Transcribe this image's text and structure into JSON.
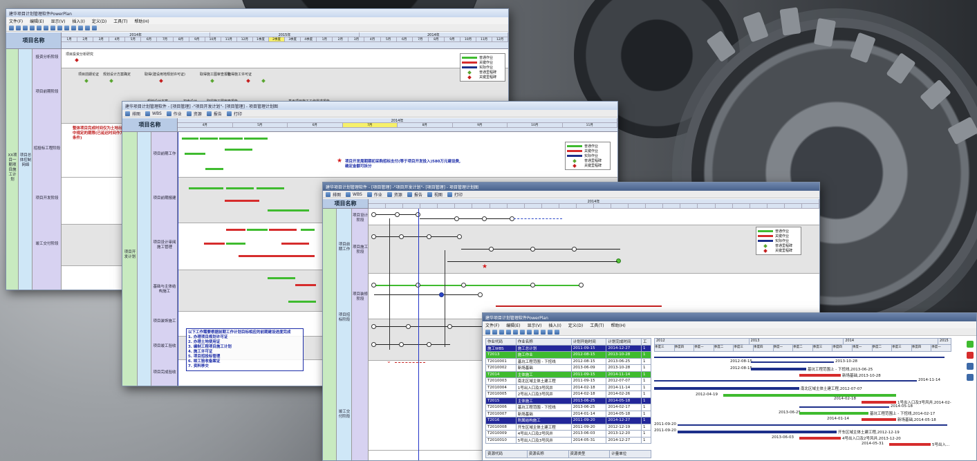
{
  "app": {
    "title": "建华项目计划管理软件PowerPlan"
  },
  "win1": {
    "title": "建华项目计划管理软件PowerPlan",
    "menu": [
      "文件(F)",
      "编辑(E)",
      "显示(V)",
      "插入(I)",
      "定义(D)",
      "工具(T)",
      "帮助(H)"
    ],
    "name_header": "项目名称",
    "years": [
      "2014年",
      "2015年",
      "2014年"
    ],
    "months": [
      "1月",
      "2月",
      "3月",
      "4月",
      "5月",
      "6月",
      "7月",
      "8月",
      "9月",
      "10月",
      "11月",
      "12月",
      "1季度",
      "2季度",
      "3季度",
      "4季度",
      "1月",
      "2月",
      "3月",
      "4月",
      "5月",
      "6月",
      "7月",
      "8月",
      "9月",
      "10月",
      "11月",
      "12月"
    ],
    "col_a": "XX项目一期项目施工计划",
    "col_b": "项目总体控制网络",
    "rows": [
      "投资分析阶段",
      "项目前期阶段",
      "招投标工程阶段",
      "项目开发阶段",
      "竣工交付阶段"
    ],
    "labels": [
      "项目投资分析研究",
      "项目前期论证",
      "规划设计方案确定",
      "取得(建设用地规划许可证)",
      "规划设计方案",
      "初步设计",
      "取得施工图审查报告",
      "取得施工许可证",
      "基于项目施工工作需求报告"
    ],
    "note": "整体项目完成时间仅为土地出让合同中规定的期限(已延迟时间作为节点条件)"
  },
  "win2": {
    "title": "建华项目计划管理软件 - [项目管理] -\"项目开发计划\"- [项目管理] - 项目管理计划图",
    "toolbar": [
      "排图",
      "WBS",
      "作业",
      "资源",
      "报告",
      "打印"
    ],
    "name_header": "项目名称",
    "years": [
      "2014年"
    ],
    "months": [
      "4月",
      "5月",
      "6月",
      "7月",
      "8月",
      "9月",
      "10月",
      "11月"
    ],
    "col_a": "项目开发计划",
    "rows": [
      "项目前期工作",
      "项目前期报建",
      "项目设计审阅施工管理",
      "基础与主体结构施工",
      "项目装饰施工",
      "项目竣工验收",
      "项目完成验收"
    ],
    "note": "项目开发周期期初采购招标支付(等于项目开发投入)580万元建设费, 确定金额可拆分",
    "box_note": [
      "以下工作需要根据前期工作计划目标相应的前期建设进度完成",
      "1. 办理项目规划许可证",
      "2. 办理土地使用证",
      "3. 编制工程项目施工计划",
      "4. 施工许可证",
      "5. 项目招投标管理",
      "6. 竣工验收备案证",
      "7. 资料移交"
    ]
  },
  "win3": {
    "title": "建华项目计划管理软件 - [项目管理] -\"项目开发计划\"- [项目管理] - 项目管理计划图",
    "toolbar": [
      "排图",
      "WBS",
      "作业",
      "资源",
      "报告",
      "视图",
      "打印"
    ],
    "name_header": "项目名称",
    "years": [
      "2014年"
    ],
    "col_a": "项目开发计划",
    "rows": [
      "项目前期工作",
      "项目招标阶段",
      "项目设计阶段",
      "项目施工阶段",
      "项目装修阶段",
      "竣工交付阶段"
    ]
  },
  "win4": {
    "title": "建华项目计划管理软件PowerPlan",
    "menu": [
      "文件(F)",
      "编辑(E)",
      "显示(V)",
      "插入(I)",
      "定义(D)",
      "工具(T)",
      "帮助(H)"
    ],
    "columns": [
      "作业代码",
      "作业名称",
      "计划开始时间",
      "计划完成时间",
      "工"
    ],
    "years": [
      "2012",
      "2013",
      "2014",
      "2015"
    ],
    "quarters": [
      "季度三",
      "季度四",
      "季度一",
      "季度二",
      "季度三",
      "季度四",
      "季度一",
      "季度二",
      "季度三",
      "季度四",
      "季度一",
      "季度二",
      "季度三",
      "季度四",
      "季度一"
    ],
    "rows": [
      {
        "type": "grp",
        "code": "施工WBS",
        "name": "施工总计划",
        "start": "2011-09-15",
        "end": "2014-12-27",
        "dur": "1"
      },
      {
        "type": "sub",
        "code": "T2013",
        "name": "施工作业",
        "start": "2012-08-15",
        "end": "2013-10-28",
        "dur": "1"
      },
      {
        "type": "norm",
        "code": "T2010001",
        "name": "基坑工程范围 - 下挖线",
        "start": "2012-08-15",
        "end": "2013-06-25",
        "dur": "1"
      },
      {
        "type": "norm",
        "code": "T2010002",
        "name": "新场基础",
        "start": "2013-06-09",
        "end": "2013-10-28",
        "dur": "1"
      },
      {
        "type": "sub",
        "code": "T2014",
        "name": "主体施工",
        "start": "2011-09-15",
        "end": "2014-11-14",
        "dur": "1"
      },
      {
        "type": "norm",
        "code": "T2010003",
        "name": "南北区域主体土建工程",
        "start": "2011-09-15",
        "end": "2012-07-07",
        "dur": "1"
      },
      {
        "type": "norm",
        "code": "T2010004",
        "name": "1号出入口及3号风井",
        "start": "2014-02-18",
        "end": "2014-11-14",
        "dur": "1"
      },
      {
        "type": "norm",
        "code": "T2010005",
        "name": "2号出入口及3号风井",
        "start": "2014-02-18",
        "end": "2014-02-26",
        "dur": "1"
      },
      {
        "type": "grp",
        "code": "T2015",
        "name": "主体施工",
        "start": "2013-06-25",
        "end": "2014-05-18",
        "dur": "1"
      },
      {
        "type": "norm",
        "code": "T2010006",
        "name": "基坑工程范围 - 下挖线",
        "start": "2013-06-25",
        "end": "2014-02-17",
        "dur": "1"
      },
      {
        "type": "norm",
        "code": "T2010007",
        "name": "新场基础",
        "start": "2014-01-14",
        "end": "2014-05-18",
        "dur": "1"
      },
      {
        "type": "grp",
        "code": "T2016",
        "name": "附属结构施工",
        "start": "2011-09-20",
        "end": "2014-12-27",
        "dur": "1"
      },
      {
        "type": "norm",
        "code": "T2010008",
        "name": "开车区域主体土建工程",
        "start": "2011-09-20",
        "end": "2012-12-19",
        "dur": "1"
      },
      {
        "type": "norm",
        "code": "T2010009",
        "name": "4号出入口及2号风井",
        "start": "2013-06-03",
        "end": "2013-12-20",
        "dur": "1"
      },
      {
        "type": "norm",
        "code": "T2010010",
        "name": "5号出入口及3号风井",
        "start": "2014-05-31",
        "end": "2014-12-27",
        "dur": "1"
      },
      {
        "type": "norm",
        "code": "T2010011",
        "name": "6号出入口及3号风井",
        "start": "2014-05-31",
        "end": "2014-12-27",
        "dur": "1"
      }
    ],
    "bottom_cols": [
      "资源代码",
      "资源名称",
      "资源类型",
      "计量单位"
    ],
    "gantt_labels": [
      {
        "t": "2013-10-28"
      },
      {
        "t": "2012-08-15"
      },
      {
        "t": "基坑工程范围上 - 下挖线,2013-06-25"
      },
      {
        "t": "2012-08-15"
      },
      {
        "t": "新场基础,2013-10-28"
      },
      {
        "t": "2014-11-14"
      },
      {
        "t": "南北区域主体土建工程,2012-07-07"
      },
      {
        "t": "2012-04-19"
      },
      {
        "t": "2014-02-18"
      },
      {
        "t": "1号出入口及3号风井,2014-02-26"
      },
      {
        "t": "2014-05-18"
      },
      {
        "t": "2013-06-25"
      },
      {
        "t": "基坑工程范围上 - 下挖线,2014-02-17"
      },
      {
        "t": "2014-01-14"
      },
      {
        "t": "新场基础,2014-05-18"
      },
      {
        "t": "2011-09-20"
      },
      {
        "t": "2011-09-20"
      },
      {
        "t": "开车区域主体土建工程,2012-12-19"
      },
      {
        "t": "2013-06-03"
      },
      {
        "t": "4号出入口及2号风井,2013-12-20"
      },
      {
        "t": "2014-05-31"
      },
      {
        "t": "5号出入..."
      }
    ]
  },
  "legend": {
    "items": [
      "普通作业",
      "关键作业",
      "实际作业",
      "普通里程碑",
      "关键里程碑"
    ]
  },
  "colors": {
    "green": "#3fbb2f",
    "red": "#d62c2c",
    "navy": "#1d2f8a",
    "blue_vline": "#2234c8"
  }
}
